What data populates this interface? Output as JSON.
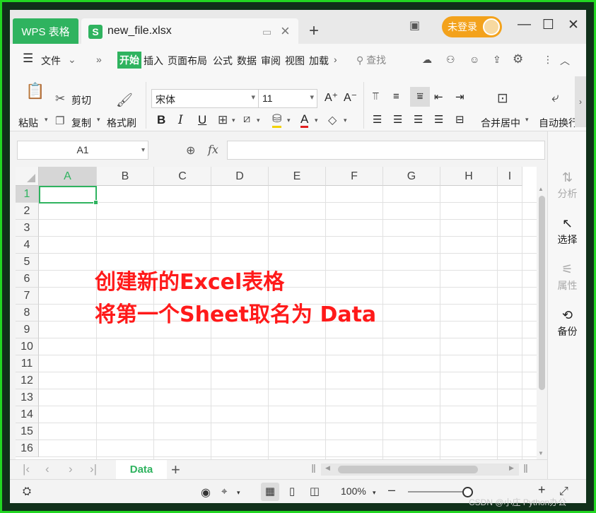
{
  "titlebar": {
    "app_tab": "WPS 表格",
    "file_tab": "new_file.xlsx",
    "new_tab": "+",
    "login": "未登录"
  },
  "menu": {
    "file": "文件",
    "items": [
      "开始",
      "插入",
      "页面布局",
      "公式",
      "数据",
      "审阅",
      "视图",
      "加载"
    ],
    "search": "查找"
  },
  "ribbon": {
    "paste": "粘贴",
    "cut": "剪切",
    "copy": "复制",
    "format_painter": "格式刷",
    "font_name": "宋体",
    "font_size": "11",
    "merge_center": "合并居中",
    "wrap_text": "自动换行"
  },
  "formula_bar": {
    "name_box": "A1",
    "fx": "fx",
    "value": ""
  },
  "grid": {
    "columns": [
      "A",
      "B",
      "C",
      "D",
      "E",
      "F",
      "G",
      "H",
      "I"
    ],
    "rows": [
      "1",
      "2",
      "3",
      "4",
      "5",
      "6",
      "7",
      "8",
      "9",
      "10",
      "11",
      "12",
      "13",
      "14",
      "15",
      "16"
    ],
    "selected_column": "A",
    "selected_row": "1"
  },
  "annotation": {
    "line1": "创建新的Excel表格",
    "line2": "将第一个Sheet取名为 Data",
    "color": "#ff1a1a"
  },
  "sheets": {
    "active": "Data",
    "add": "+"
  },
  "right_panel": {
    "items": [
      "分析",
      "选择",
      "属性",
      "备份"
    ]
  },
  "status": {
    "zoom": "100%"
  },
  "watermark": "CSDN @小庄 Python办公",
  "colors": {
    "accent": "#2fb35f",
    "login": "#f3a21c",
    "frame": "#22d622"
  }
}
